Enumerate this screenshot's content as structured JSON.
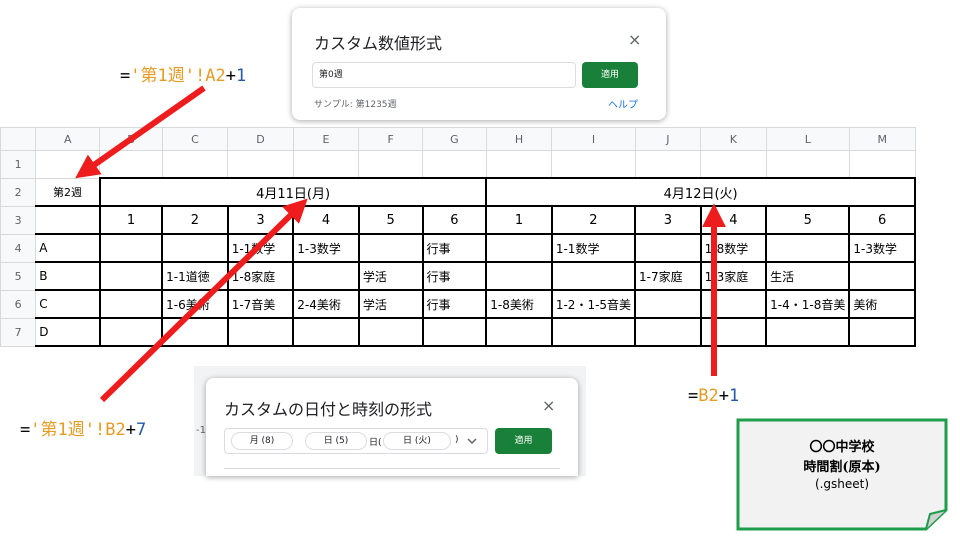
{
  "sheet": {
    "col_headers": [
      "A",
      "B",
      "C",
      "D",
      "E",
      "F",
      "G",
      "H",
      "I",
      "J",
      "K",
      "L",
      "M"
    ],
    "row_headers": [
      "1",
      "2",
      "3",
      "4",
      "5",
      "6",
      "7"
    ],
    "week_label": "第2週",
    "dates": [
      "4月11日(月)",
      "4月12日(火)"
    ],
    "periods": [
      "1",
      "2",
      "3",
      "4",
      "5",
      "6",
      "1",
      "2",
      "3",
      "4",
      "5",
      "6"
    ],
    "rows": [
      {
        "label": "A",
        "cells": [
          "",
          "",
          "1-1数学",
          "1-3数学",
          "",
          "行事",
          "",
          "1-1数学",
          "",
          "1-8数学",
          "",
          "1-3数学"
        ]
      },
      {
        "label": "B",
        "cells": [
          "",
          "1-1道徳",
          "1-8家庭",
          "",
          "学活",
          "行事",
          "",
          "",
          "1-7家庭",
          "1-3家庭",
          "生活",
          ""
        ]
      },
      {
        "label": "C",
        "cells": [
          "",
          "1-6美術",
          "1-7音美",
          "2-4美術",
          "学活",
          "行事",
          "1-8美術",
          "1-2・1-5音美",
          "",
          "",
          "1-4・1-8音美",
          "美術"
        ]
      },
      {
        "label": "D",
        "cells": [
          "",
          "",
          "",
          "",
          "",
          "",
          "",
          "",
          "",
          "",
          "",
          ""
        ]
      }
    ]
  },
  "dialog_number": {
    "title": "カスタム数値形式",
    "close": "×",
    "input_value": "第0週",
    "apply": "適用",
    "sample": "サンプル: 第1235週",
    "help": "ヘルプ"
  },
  "dialog_date": {
    "title": "カスタムの日付と時刻の形式",
    "close": "×",
    "apply": "適用",
    "seg_month": "月 (8)",
    "seg_day": "日 (5)",
    "sep_day": "日(",
    "seg_weekday": "日 (火)",
    "sep_close": ")",
    "edge_text": "-1"
  },
  "formulas": {
    "top": {
      "eq": "=",
      "str": "'第1週'!",
      "ref": "A2",
      "op": "+",
      "num": "1"
    },
    "bottom_left": {
      "eq": "=",
      "str": "'第1週'!",
      "ref": "B2",
      "op": "+",
      "num": "7"
    },
    "right": {
      "eq": "=",
      "ref": "B2",
      "op": "+",
      "num": "1"
    }
  },
  "note": {
    "line1": "〇〇中学校",
    "line2": "時間割(原本)",
    "line3": "(.gsheet)"
  },
  "colors": {
    "arrow": "#ee1c1c",
    "apply_button": "#188038",
    "note_border": "#1e9e4a",
    "formula_orange": "#e69b25",
    "formula_blue": "#2459a8"
  }
}
